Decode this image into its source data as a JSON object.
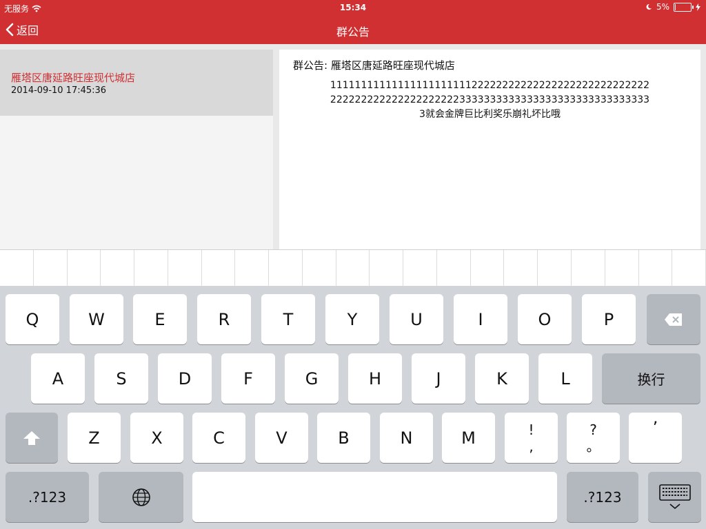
{
  "status_bar": {
    "carrier": "无服务",
    "time": "15:34",
    "battery_percent": "5%",
    "battery_level": 0.05
  },
  "nav": {
    "back_label": "返回",
    "title": "群公告"
  },
  "list": {
    "items": [
      {
        "title": "雁塔区唐延路旺座现代城店",
        "time": "2014-09-10 17:45:36"
      }
    ]
  },
  "detail": {
    "title": "群公告: 雁塔区唐延路旺座现代城店",
    "body_lines": [
      "1111111111111111111111122222222222222222222222222222",
      "2222222222222222222223333333333333333333333333333333",
      "3就会金牌巨比利奖乐崩礼坏比哦"
    ]
  },
  "keyboard": {
    "row1": [
      "Q",
      "W",
      "E",
      "R",
      "T",
      "Y",
      "U",
      "I",
      "O",
      "P"
    ],
    "row2": [
      "A",
      "S",
      "D",
      "F",
      "G",
      "H",
      "J",
      "K",
      "L"
    ],
    "return_label": "换行",
    "row3": [
      "Z",
      "X",
      "C",
      "V",
      "B",
      "N",
      "M"
    ],
    "punct1_top": "!",
    "punct1_bottom": ",",
    "punct2_top": "?",
    "punct2_bottom": "。",
    "punct3": "’",
    "numbers_label": ".?123",
    "icons": {
      "delete": "delete-icon",
      "shift": "shift-icon",
      "globe": "globe-icon",
      "dismiss": "keyboard-dismiss-icon"
    }
  },
  "colors": {
    "accent": "#d13033",
    "keyboard_bg": "#d1d4d9"
  }
}
